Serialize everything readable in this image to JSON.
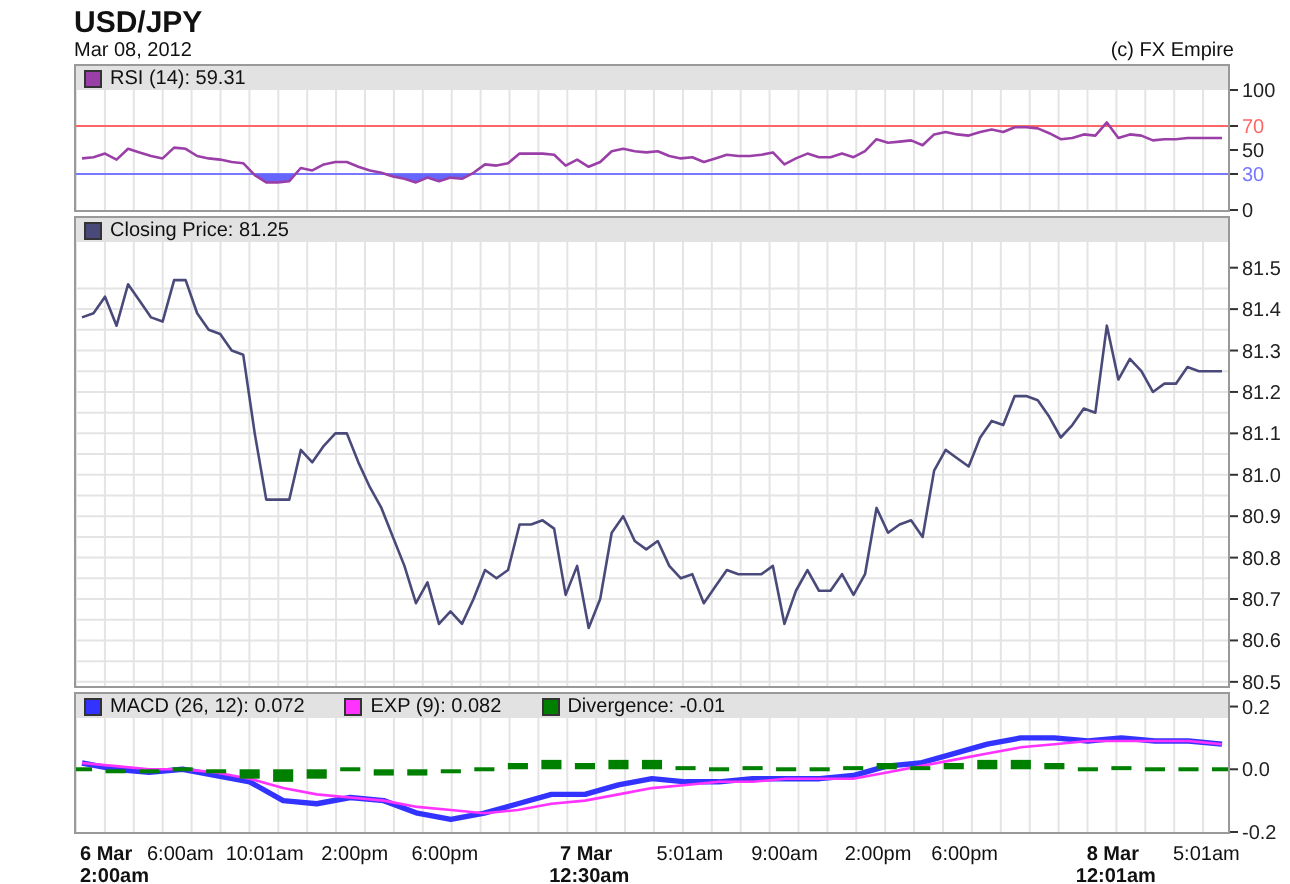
{
  "title": "USD/JPY",
  "date": "Mar 08, 2012",
  "credit": "(c) FX Empire",
  "panels": [
    {
      "kind": "rsi",
      "chart_data": {
        "type": "line",
        "grid": true,
        "legend": true,
        "ylim": [
          0,
          120
        ],
        "yticks": [
          0,
          30,
          50,
          70,
          100
        ],
        "ref_lines": [
          {
            "axis": "y",
            "value": 70,
            "color": "#ff6666"
          },
          {
            "axis": "y",
            "value": 30,
            "color": "#7777ff"
          }
        ],
        "series": [
          {
            "name": "RSI (14): 59.31",
            "color": "#9a3fa8",
            "values": [
              43,
              44,
              47,
              42,
              51,
              48,
              45,
              43,
              52,
              51,
              45,
              43,
              42,
              40,
              39,
              29,
              23,
              23,
              24,
              35,
              33,
              38,
              40,
              40,
              36,
              33,
              31,
              28,
              26,
              23,
              27,
              24,
              27,
              26,
              31,
              38,
              37,
              39,
              47,
              47,
              47,
              46,
              37,
              42,
              36,
              40,
              49,
              51,
              49,
              48,
              49,
              45,
              43,
              44,
              40,
              43,
              46,
              45,
              45,
              46,
              48,
              38,
              43,
              47,
              44,
              44,
              47,
              44,
              49,
              59,
              56,
              57,
              58,
              54,
              63,
              65,
              63,
              62,
              65,
              67,
              65,
              69,
              69,
              68,
              64,
              59,
              60,
              63,
              62,
              73,
              60,
              63,
              62,
              58,
              59,
              59,
              60,
              60,
              60,
              60
            ]
          }
        ]
      }
    },
    {
      "kind": "price",
      "chart_data": {
        "type": "line",
        "grid": true,
        "legend": true,
        "ylim": [
          80.49,
          81.62
        ],
        "yticks": [
          {
            "value": 80.5,
            "label": "80.5"
          },
          {
            "value": 80.6,
            "label": "80.6"
          },
          {
            "value": 80.7,
            "label": "80.7"
          },
          {
            "value": 80.8,
            "label": "80.8"
          },
          {
            "value": 80.9,
            "label": "80.9"
          },
          {
            "value": 81.0,
            "label": "81.0"
          },
          {
            "value": 81.1,
            "label": "81.1"
          },
          {
            "value": 81.2,
            "label": "81.2"
          },
          {
            "value": 81.3,
            "label": "81.3"
          },
          {
            "value": 81.4,
            "label": "81.4"
          },
          {
            "value": 81.5,
            "label": "81.5"
          }
        ],
        "series": [
          {
            "name": "Closing Price: 81.25",
            "color": "#4a4a7a",
            "values": [
              81.38,
              81.39,
              81.43,
              81.36,
              81.46,
              81.42,
              81.38,
              81.37,
              81.47,
              81.47,
              81.39,
              81.35,
              81.34,
              81.3,
              81.29,
              81.1,
              80.94,
              80.94,
              80.94,
              81.06,
              81.03,
              81.07,
              81.1,
              81.1,
              81.03,
              80.97,
              80.92,
              80.85,
              80.78,
              80.69,
              80.74,
              80.64,
              80.67,
              80.64,
              80.7,
              80.77,
              80.75,
              80.77,
              80.88,
              80.88,
              80.89,
              80.87,
              80.71,
              80.78,
              80.63,
              80.7,
              80.86,
              80.9,
              80.84,
              80.82,
              80.84,
              80.78,
              80.75,
              80.76,
              80.69,
              80.73,
              80.77,
              80.76,
              80.76,
              80.76,
              80.78,
              80.64,
              80.72,
              80.77,
              80.72,
              80.72,
              80.76,
              80.71,
              80.76,
              80.92,
              80.86,
              80.88,
              80.89,
              80.85,
              81.01,
              81.06,
              81.04,
              81.02,
              81.09,
              81.13,
              81.12,
              81.19,
              81.19,
              81.18,
              81.14,
              81.09,
              81.12,
              81.16,
              81.15,
              81.36,
              81.23,
              81.28,
              81.25,
              81.2,
              81.22,
              81.22,
              81.26,
              81.25,
              81.25,
              81.25
            ]
          }
        ]
      }
    },
    {
      "kind": "macd",
      "chart_data": {
        "type": "line",
        "grid": true,
        "legend": true,
        "ylim": [
          -0.2,
          0.24
        ],
        "yticks": [
          {
            "value": -0.2,
            "label": "-0.2"
          },
          {
            "value": 0,
            "label": "0.0"
          },
          {
            "value": 0.2,
            "label": "0.2"
          }
        ],
        "series": [
          {
            "name": "MACD (26, 12): 0.072",
            "color": "#3333ff",
            "values": [
              0.02,
              0.0,
              -0.01,
              0.0,
              -0.02,
              -0.04,
              -0.1,
              -0.11,
              -0.09,
              -0.1,
              -0.14,
              -0.16,
              -0.14,
              -0.11,
              -0.08,
              -0.08,
              -0.05,
              -0.03,
              -0.04,
              -0.04,
              -0.03,
              -0.03,
              -0.03,
              -0.02,
              0.01,
              0.02,
              0.05,
              0.08,
              0.1,
              0.1,
              0.09,
              0.1,
              0.09,
              0.09,
              0.08
            ]
          },
          {
            "name": "EXP (9): 0.082",
            "color": "#ff33ff",
            "values": [
              0.02,
              0.01,
              0.0,
              0.0,
              -0.01,
              -0.03,
              -0.06,
              -0.08,
              -0.09,
              -0.1,
              -0.12,
              -0.13,
              -0.14,
              -0.13,
              -0.11,
              -0.1,
              -0.08,
              -0.06,
              -0.05,
              -0.04,
              -0.04,
              -0.03,
              -0.03,
              -0.03,
              -0.01,
              0.01,
              0.03,
              0.05,
              0.07,
              0.08,
              0.09,
              0.09,
              0.09,
              0.09,
              0.08
            ]
          },
          {
            "name": "Divergence: -0.01",
            "color": "#008000",
            "type": "bar",
            "values": [
              0.0,
              -0.01,
              -0.01,
              0.0,
              -0.01,
              -0.03,
              -0.04,
              -0.03,
              0.0,
              -0.02,
              -0.02,
              -0.01,
              0.0,
              0.02,
              0.03,
              0.02,
              0.03,
              0.03,
              0.01,
              0.0,
              0.01,
              0.0,
              0.0,
              0.01,
              0.02,
              0.01,
              0.02,
              0.03,
              0.03,
              0.02,
              0.0,
              0.01,
              0.0,
              0.0,
              0.0
            ]
          }
        ]
      }
    }
  ],
  "x_axis": [
    {
      "label": "6 Mar 2:00am",
      "kind": "date"
    },
    {
      "label": "6:00am",
      "kind": "time"
    },
    {
      "label": "10:01am",
      "kind": "time"
    },
    {
      "label": "2:00pm",
      "kind": "time"
    },
    {
      "label": "6:00pm",
      "kind": "time"
    },
    {
      "label": "7 Mar 12:30am",
      "kind": "date"
    },
    {
      "label": "5:01am",
      "kind": "time"
    },
    {
      "label": "9:00am",
      "kind": "time"
    },
    {
      "label": "2:00pm",
      "kind": "time"
    },
    {
      "label": "6:00pm",
      "kind": "time"
    },
    {
      "label": "8 Mar 12:01am",
      "kind": "date"
    },
    {
      "label": "5:01am",
      "kind": "time"
    }
  ]
}
